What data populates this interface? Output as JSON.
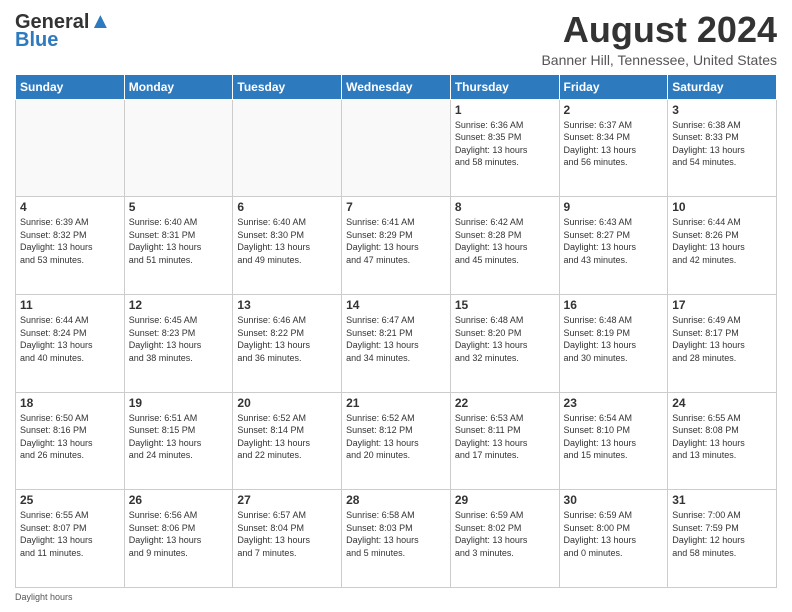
{
  "header": {
    "logo_line1": "General",
    "logo_line2": "Blue",
    "month_year": "August 2024",
    "location": "Banner Hill, Tennessee, United States"
  },
  "days_of_week": [
    "Sunday",
    "Monday",
    "Tuesday",
    "Wednesday",
    "Thursday",
    "Friday",
    "Saturday"
  ],
  "weeks": [
    [
      {
        "day": "",
        "info": ""
      },
      {
        "day": "",
        "info": ""
      },
      {
        "day": "",
        "info": ""
      },
      {
        "day": "",
        "info": ""
      },
      {
        "day": "1",
        "info": "Sunrise: 6:36 AM\nSunset: 8:35 PM\nDaylight: 13 hours\nand 58 minutes."
      },
      {
        "day": "2",
        "info": "Sunrise: 6:37 AM\nSunset: 8:34 PM\nDaylight: 13 hours\nand 56 minutes."
      },
      {
        "day": "3",
        "info": "Sunrise: 6:38 AM\nSunset: 8:33 PM\nDaylight: 13 hours\nand 54 minutes."
      }
    ],
    [
      {
        "day": "4",
        "info": "Sunrise: 6:39 AM\nSunset: 8:32 PM\nDaylight: 13 hours\nand 53 minutes."
      },
      {
        "day": "5",
        "info": "Sunrise: 6:40 AM\nSunset: 8:31 PM\nDaylight: 13 hours\nand 51 minutes."
      },
      {
        "day": "6",
        "info": "Sunrise: 6:40 AM\nSunset: 8:30 PM\nDaylight: 13 hours\nand 49 minutes."
      },
      {
        "day": "7",
        "info": "Sunrise: 6:41 AM\nSunset: 8:29 PM\nDaylight: 13 hours\nand 47 minutes."
      },
      {
        "day": "8",
        "info": "Sunrise: 6:42 AM\nSunset: 8:28 PM\nDaylight: 13 hours\nand 45 minutes."
      },
      {
        "day": "9",
        "info": "Sunrise: 6:43 AM\nSunset: 8:27 PM\nDaylight: 13 hours\nand 43 minutes."
      },
      {
        "day": "10",
        "info": "Sunrise: 6:44 AM\nSunset: 8:26 PM\nDaylight: 13 hours\nand 42 minutes."
      }
    ],
    [
      {
        "day": "11",
        "info": "Sunrise: 6:44 AM\nSunset: 8:24 PM\nDaylight: 13 hours\nand 40 minutes."
      },
      {
        "day": "12",
        "info": "Sunrise: 6:45 AM\nSunset: 8:23 PM\nDaylight: 13 hours\nand 38 minutes."
      },
      {
        "day": "13",
        "info": "Sunrise: 6:46 AM\nSunset: 8:22 PM\nDaylight: 13 hours\nand 36 minutes."
      },
      {
        "day": "14",
        "info": "Sunrise: 6:47 AM\nSunset: 8:21 PM\nDaylight: 13 hours\nand 34 minutes."
      },
      {
        "day": "15",
        "info": "Sunrise: 6:48 AM\nSunset: 8:20 PM\nDaylight: 13 hours\nand 32 minutes."
      },
      {
        "day": "16",
        "info": "Sunrise: 6:48 AM\nSunset: 8:19 PM\nDaylight: 13 hours\nand 30 minutes."
      },
      {
        "day": "17",
        "info": "Sunrise: 6:49 AM\nSunset: 8:17 PM\nDaylight: 13 hours\nand 28 minutes."
      }
    ],
    [
      {
        "day": "18",
        "info": "Sunrise: 6:50 AM\nSunset: 8:16 PM\nDaylight: 13 hours\nand 26 minutes."
      },
      {
        "day": "19",
        "info": "Sunrise: 6:51 AM\nSunset: 8:15 PM\nDaylight: 13 hours\nand 24 minutes."
      },
      {
        "day": "20",
        "info": "Sunrise: 6:52 AM\nSunset: 8:14 PM\nDaylight: 13 hours\nand 22 minutes."
      },
      {
        "day": "21",
        "info": "Sunrise: 6:52 AM\nSunset: 8:12 PM\nDaylight: 13 hours\nand 20 minutes."
      },
      {
        "day": "22",
        "info": "Sunrise: 6:53 AM\nSunset: 8:11 PM\nDaylight: 13 hours\nand 17 minutes."
      },
      {
        "day": "23",
        "info": "Sunrise: 6:54 AM\nSunset: 8:10 PM\nDaylight: 13 hours\nand 15 minutes."
      },
      {
        "day": "24",
        "info": "Sunrise: 6:55 AM\nSunset: 8:08 PM\nDaylight: 13 hours\nand 13 minutes."
      }
    ],
    [
      {
        "day": "25",
        "info": "Sunrise: 6:55 AM\nSunset: 8:07 PM\nDaylight: 13 hours\nand 11 minutes."
      },
      {
        "day": "26",
        "info": "Sunrise: 6:56 AM\nSunset: 8:06 PM\nDaylight: 13 hours\nand 9 minutes."
      },
      {
        "day": "27",
        "info": "Sunrise: 6:57 AM\nSunset: 8:04 PM\nDaylight: 13 hours\nand 7 minutes."
      },
      {
        "day": "28",
        "info": "Sunrise: 6:58 AM\nSunset: 8:03 PM\nDaylight: 13 hours\nand 5 minutes."
      },
      {
        "day": "29",
        "info": "Sunrise: 6:59 AM\nSunset: 8:02 PM\nDaylight: 13 hours\nand 3 minutes."
      },
      {
        "day": "30",
        "info": "Sunrise: 6:59 AM\nSunset: 8:00 PM\nDaylight: 13 hours\nand 0 minutes."
      },
      {
        "day": "31",
        "info": "Sunrise: 7:00 AM\nSunset: 7:59 PM\nDaylight: 12 hours\nand 58 minutes."
      }
    ]
  ],
  "footer": {
    "note": "Daylight hours"
  }
}
